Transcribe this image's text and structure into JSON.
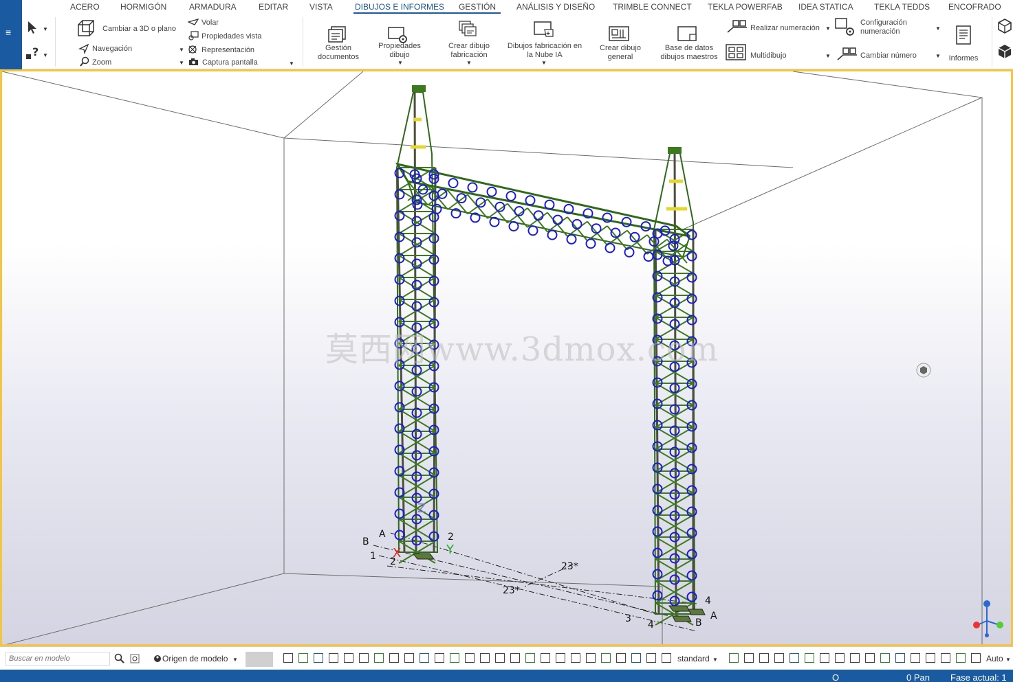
{
  "tabs": [
    "ACERO",
    "HORMIGÓN",
    "ARMADURA",
    "EDITAR",
    "VISTA",
    "DIBUJOS E INFORMES",
    "GESTIÓN",
    "ANÁLISIS Y DISEÑO",
    "TRIMBLE CONNECT",
    "TEKLA POWERFAB",
    "IDEA STATICA",
    "TEKLA TEDDS",
    "ENCOFRADO"
  ],
  "active_tab": "DIBUJOS E INFORMES",
  "ribbon": {
    "cambiar": "Cambiar a 3D o plano",
    "navegacion": "Navegación",
    "zoom": "Zoom",
    "volar": "Volar",
    "propiedades_vista": "Propiedades vista",
    "representacion": "Representación",
    "captura": "Captura pantalla",
    "gestion_1": "Gestión",
    "gestion_2": "documentos",
    "prop_dibujo_1": "Propiedades",
    "prop_dibujo_2": "dibujo",
    "crear_fab_1": "Crear dibujo",
    "crear_fab_2": "fabricación",
    "nube_1": "Dibujos fabricación en",
    "nube_2": "la Nube IA",
    "general_1": "Crear dibujo",
    "general_2": "general",
    "base_1": "Base de datos",
    "base_2": "dibujos maestros",
    "realizar": "Realizar numeración",
    "multidibujo": "Multidibujo",
    "config_1": "Configuración",
    "config_2": "numeración",
    "cambiar_numero": "Cambiar número",
    "informes": "Informes"
  },
  "viewport": {
    "watermark": "莫西网www.3dmox.com",
    "grid_labels": {
      "a1": "A",
      "b1": "B",
      "n1": "1",
      "n2": "2",
      "n2b": "2",
      "t23a": "23*",
      "t23b": "23*",
      "n3": "3",
      "n4a": "4",
      "n4b": "4",
      "a2": "A",
      "b2": "B",
      "axis_x": "X",
      "axis_y": "Y",
      "axis_z": "Z"
    }
  },
  "statusbar": {
    "search_placeholder": "Buscar en modelo",
    "origin": "Origen de modelo",
    "view_mode": "standard",
    "auto": "Auto"
  },
  "bottombar": {
    "o": "O",
    "pan": "0  Pan",
    "fase": "Fase actual: 1"
  },
  "colors": {
    "accent": "#1a5aa0",
    "viewport_border": "#f5c542",
    "tower_green": "#3c7a1e",
    "bolt_blue": "#1b1bd6"
  }
}
